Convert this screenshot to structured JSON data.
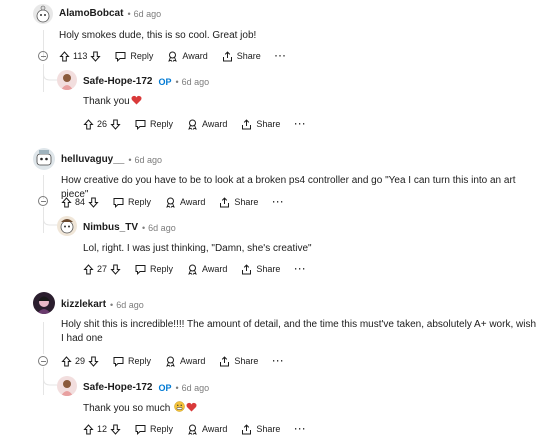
{
  "comments": [
    {
      "author": "AlamoBobcat",
      "op_badge": "",
      "time": "6d ago",
      "text": "Holy smokes dude, this is so cool. Great job!",
      "votes": "113",
      "labels": {
        "reply": "Reply",
        "award": "Award",
        "share": "Share",
        "more": "···"
      }
    },
    {
      "author": "Safe-Hope-172",
      "op_badge": "OP",
      "time": "6d ago",
      "text": "Thank you",
      "votes": "26",
      "labels": {
        "reply": "Reply",
        "award": "Award",
        "share": "Share",
        "more": "···"
      }
    },
    {
      "author": "helluvaguy__",
      "op_badge": "",
      "time": "6d ago",
      "text": "How creative do you have to be to look at a broken ps4 controller and go \"Yea I can turn this into an art piece\"",
      "votes": "84",
      "labels": {
        "reply": "Reply",
        "award": "Award",
        "share": "Share",
        "more": "···"
      }
    },
    {
      "author": "Nimbus_TV",
      "op_badge": "",
      "time": "6d ago",
      "text": "Lol, right. I was just thinking, \"Damn, she's creative\"",
      "votes": "27",
      "labels": {
        "reply": "Reply",
        "award": "Award",
        "share": "Share",
        "more": "···"
      }
    },
    {
      "author": "kizzlekart",
      "op_badge": "",
      "time": "6d ago",
      "text": "Holy shit this is incredible!!!! The amount of detail, and the time this must've taken, absolutely A+ work, wish I had one",
      "votes": "29",
      "labels": {
        "reply": "Reply",
        "award": "Award",
        "share": "Share",
        "more": "···"
      }
    },
    {
      "author": "Safe-Hope-172",
      "op_badge": "OP",
      "time": "6d ago",
      "text": "Thank you so much",
      "votes": "12",
      "labels": {
        "reply": "Reply",
        "award": "Award",
        "share": "Share",
        "more": "···"
      }
    }
  ],
  "separator": "•",
  "colors": {
    "op": "#0079d3",
    "meta": "#7c7c7c",
    "heart": "#d93a3a",
    "thread_line": "#e5e5e5"
  },
  "icons": [
    "upvote-icon",
    "downvote-icon",
    "reply-icon",
    "award-icon",
    "share-icon",
    "heart-emoji-icon",
    "grimace-emoji-icon"
  ]
}
